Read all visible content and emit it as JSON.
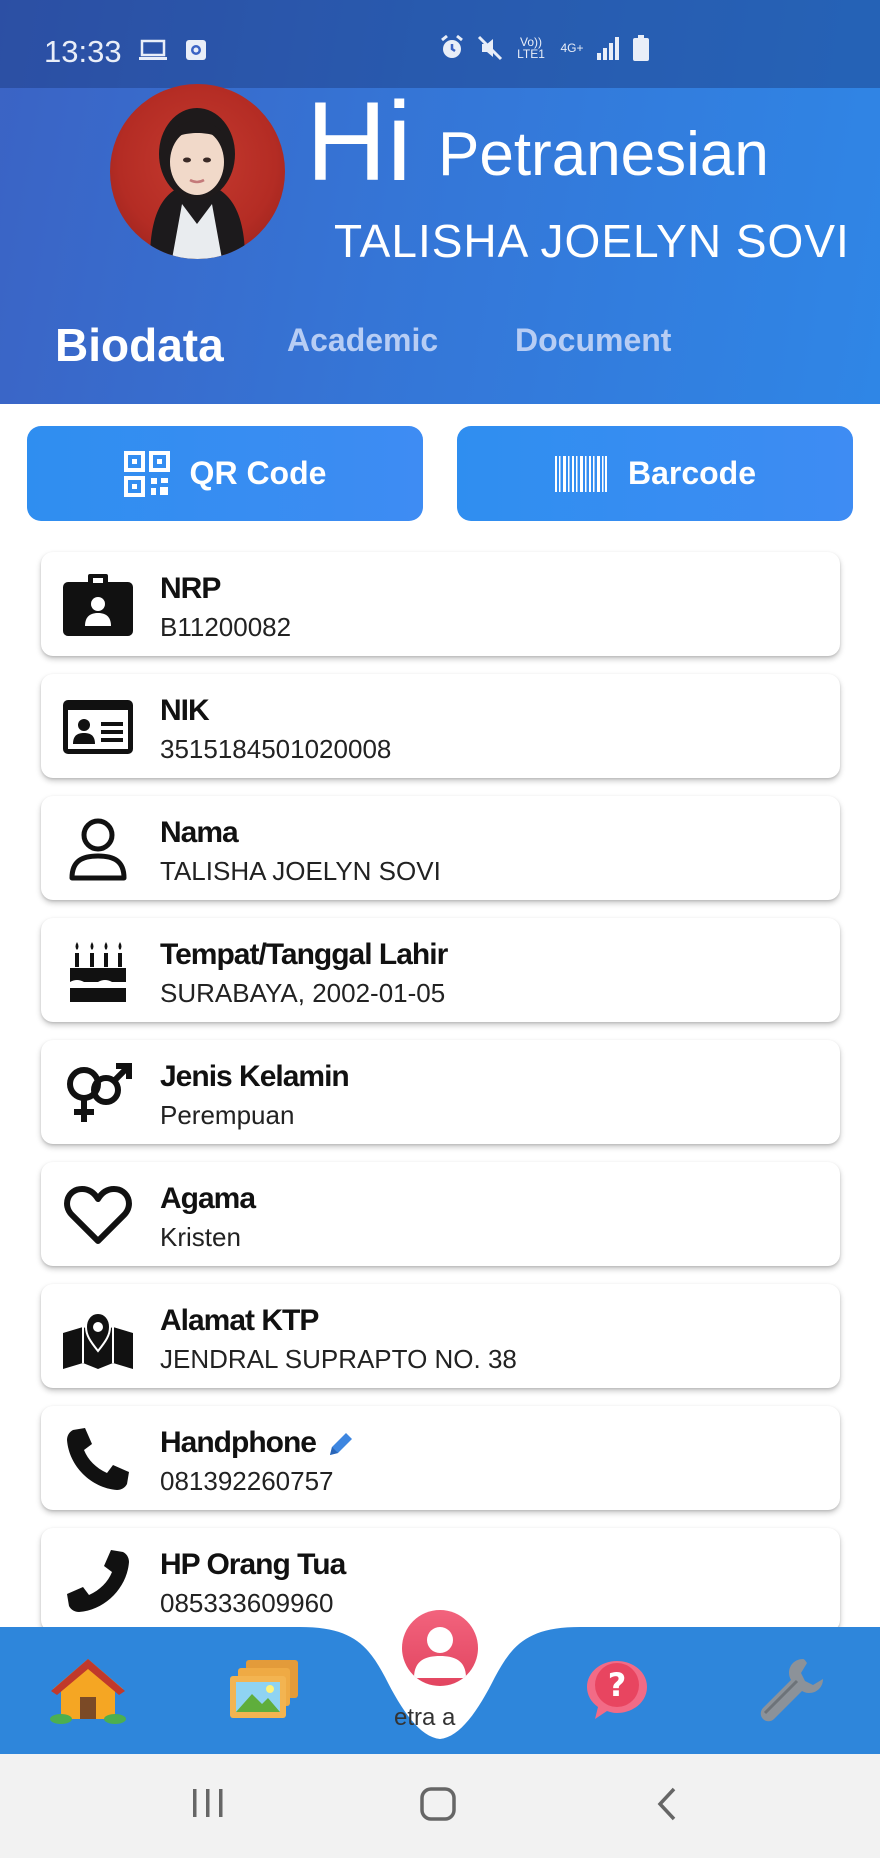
{
  "status_bar": {
    "time": "13:33",
    "network_volte": "Vo)) LTE1",
    "network_4g": "4G+"
  },
  "header": {
    "greeting": "Hi",
    "greeting_name": "Petranesian",
    "full_name": "TALISHA JOELYN SOVI"
  },
  "tabs": [
    {
      "label": "Biodata",
      "active": true
    },
    {
      "label": "Academic",
      "active": false
    },
    {
      "label": "Document",
      "active": false
    }
  ],
  "code_buttons": {
    "qr_label": "QR Code",
    "barcode_label": "Barcode"
  },
  "fields": [
    {
      "label": "NRP",
      "value": "B11200082",
      "icon": "id-badge-icon"
    },
    {
      "label": "NIK",
      "value": "3515184501020008",
      "icon": "id-card-icon"
    },
    {
      "label": "Nama",
      "value": "TALISHA JOELYN SOVI",
      "icon": "user-icon"
    },
    {
      "label": "Tempat/Tanggal Lahir",
      "value": "SURABAYA, 2002-01-05",
      "icon": "birthday-cake-icon"
    },
    {
      "label": "Jenis Kelamin",
      "value": "Perempuan",
      "icon": "gender-icon"
    },
    {
      "label": "Agama",
      "value": "Kristen",
      "icon": "heart-icon"
    },
    {
      "label": "Alamat KTP",
      "value": "JENDRAL SUPRAPTO NO. 38",
      "icon": "map-marker-icon"
    },
    {
      "label": "Handphone",
      "value": "081392260757",
      "icon": "phone-icon",
      "editable": true
    },
    {
      "label": "HP Orang Tua",
      "value": "085333609960",
      "icon": "phone-alt-icon"
    }
  ],
  "bottom_nav": {
    "items": [
      "home-icon",
      "gallery-icon",
      "profile-icon",
      "help-icon",
      "settings-wrench-icon"
    ],
    "center_label": "etra a"
  },
  "colors": {
    "header_start": "#3b63c4",
    "header_end": "#2f86e6",
    "button_blue": "#3e8cf3",
    "nav_blue": "#2e86db",
    "fab_pink": "#e24560"
  }
}
